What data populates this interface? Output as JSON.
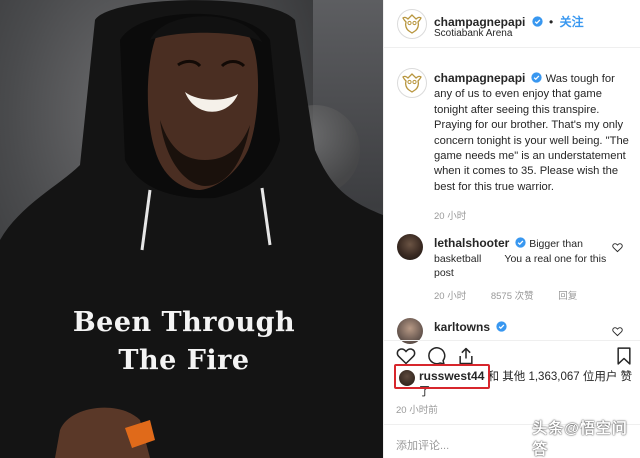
{
  "photo": {
    "hoodie_line1": "Been Through",
    "hoodie_line2": "The Fire"
  },
  "header": {
    "username": "champagnepapi",
    "separator": "•",
    "follow_label": "关注",
    "location": "Scotiabank Arena"
  },
  "caption": {
    "username": "champagnepapi",
    "text": "Was tough for any of us to even enjoy that game tonight after seeing this transpire. Praying for our brother. That's my only concern tonight is your well being. \"The game needs me\" is an understatement when it comes to 35. Please wish the best for this true warrior.",
    "time": "20 小时"
  },
  "comments": [
    {
      "username": "lethalshooter",
      "text": "Bigger than basketball        You a real one for this post",
      "time": "20 小时",
      "likes": "8575 次赞",
      "reply": "回复"
    },
    {
      "username": "karltowns"
    }
  ],
  "likes": {
    "username": "russwest44",
    "rest": "和 其他 1,363,067 位用户 赞了"
  },
  "post_time": "20 小时前",
  "add_comment_placeholder": "添加评论...",
  "watermark": "头条@悟空问答",
  "colors": {
    "link_blue": "#3897f0",
    "verified_blue": "#3897f0",
    "highlight_red": "#d7262c",
    "muted_gray": "#999999"
  },
  "icons": {
    "heart": "heart-icon",
    "comment": "comment-icon",
    "share": "share-icon",
    "save": "bookmark-icon",
    "verified": "verified-badge-icon",
    "owl": "owl-logo-icon"
  }
}
